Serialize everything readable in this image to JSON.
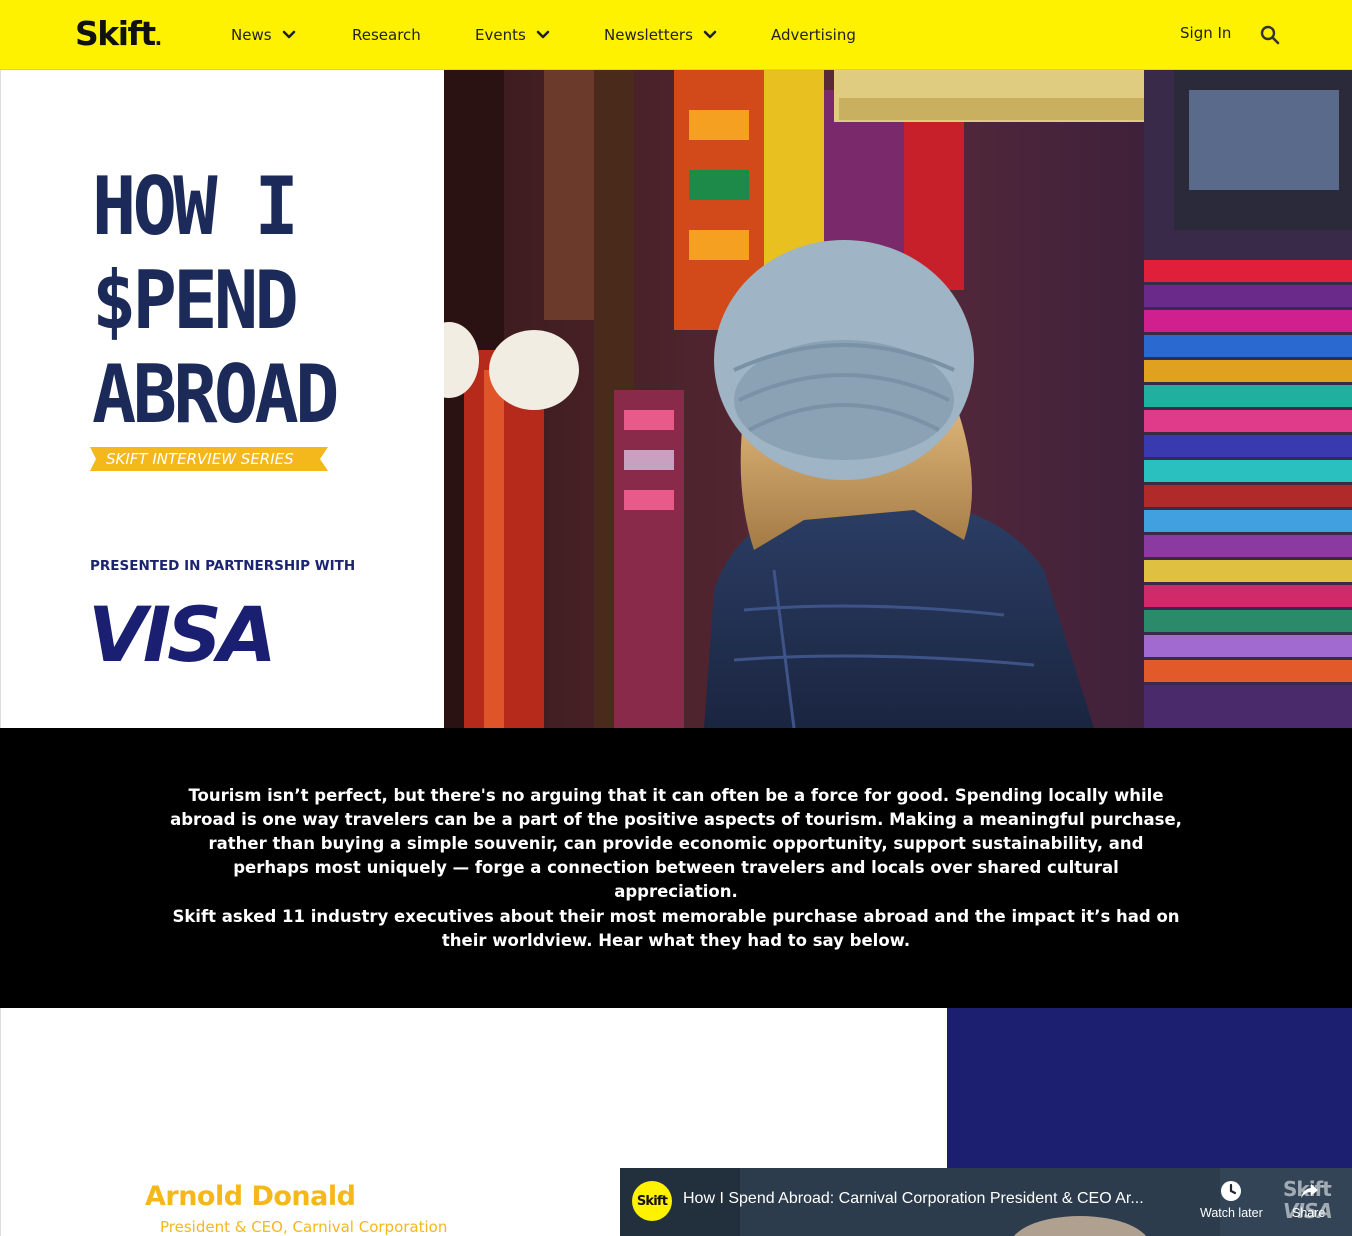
{
  "header": {
    "logo": "Skift",
    "nav": [
      {
        "label": "News",
        "has_dropdown": true
      },
      {
        "label": "Research",
        "has_dropdown": false
      },
      {
        "label": "Events",
        "has_dropdown": true
      },
      {
        "label": "Newsletters",
        "has_dropdown": true
      },
      {
        "label": "Advertising",
        "has_dropdown": false
      }
    ],
    "sign_in": "Sign In",
    "search_icon": "search-icon"
  },
  "hero": {
    "title_lines": [
      "HOW I",
      "$PEND",
      "ABROAD"
    ],
    "series_label": "SKIFT INTERVIEW SERIES",
    "partner_label": "PRESENTED IN PARTNERSHIP WITH",
    "partner_logo": "VISA"
  },
  "intro": {
    "paragraph1": "Tourism isn’t perfect, but there's no arguing that it can often be a force for good. Spending locally while abroad is one way travelers can be a part of the positive aspects of tourism. Making a meaningful purchase, rather than buying a simple souvenir, can provide economic opportunity, support sustainability, and perhaps most uniquely — forge a connection between travelers and locals over shared cultural appreciation.",
    "paragraph2": "Skift asked 11 industry executives about their most memorable purchase abroad and the impact it’s had on their worldview. Hear what they had to say below."
  },
  "feature": {
    "name": "Arnold Donald",
    "role": "President & CEO, Carnival Corporation"
  },
  "video": {
    "channel_badge": "Skift",
    "title": "How I Spend Abroad: Carnival Corporation President & CEO Ar...",
    "watch_later": "Watch later",
    "share": "Share",
    "watermark_top": "Skift",
    "watermark_bottom": "VISA"
  },
  "colors": {
    "header_bg": "#fff200",
    "navy": "#1c2a5a",
    "visa_blue": "#1a1f71",
    "gold": "#f5b81c",
    "intro_bg": "#000000",
    "navy_block": "#1c1f70"
  }
}
